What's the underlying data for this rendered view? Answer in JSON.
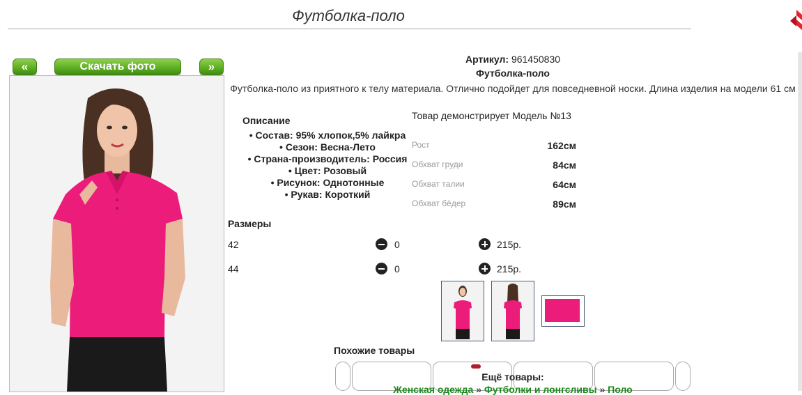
{
  "header": {
    "title": "Футболка-поло"
  },
  "gallery": {
    "prev_label": "«",
    "download_label": "Скачать фото",
    "next_label": "»"
  },
  "product": {
    "sku_label": "Артикул:",
    "sku_value": "961450830",
    "name": "Футболка-поло",
    "description": "Футболка-поло из приятного к телу материала. Отлично подойдет для повседневной носки. Длина изделия на модели 61 см"
  },
  "specs": {
    "title": "Описание",
    "items": [
      "Состав: 95% хлопок,5% лайкра",
      "Сезон: Весна-Лето",
      "Страна-производитель: Россия",
      "Цвет: Розовый",
      "Рисунок: Однотонные",
      "Рукав: Короткий"
    ]
  },
  "model": {
    "heading": "Товар демонстрирует Модель №13",
    "measurements": [
      {
        "label": "Рост",
        "value": "162см"
      },
      {
        "label": "Обхват груди",
        "value": "84см"
      },
      {
        "label": "Обхват талии",
        "value": "64см"
      },
      {
        "label": "Обхват бёдер",
        "value": "89см"
      }
    ]
  },
  "sizes": {
    "title": "Размеры",
    "rows": [
      {
        "size": "42",
        "qty": "0",
        "price": "215р."
      },
      {
        "size": "44",
        "qty": "0",
        "price": "215р."
      }
    ]
  },
  "similar": {
    "title": "Похожие товары"
  },
  "more": {
    "title": "Ещё товары:",
    "crumbs": [
      "Женская одежда",
      "Футболки и лонгсливы",
      "Поло"
    ],
    "separator": "»"
  },
  "colors": {
    "accent_green": "#5fae22",
    "shirt_pink": "#ec1c7a",
    "link_green": "#1a8a1a"
  },
  "icons": {
    "close": "close-x-icon",
    "minus": "minus-circle-icon",
    "plus": "plus-circle-icon"
  }
}
